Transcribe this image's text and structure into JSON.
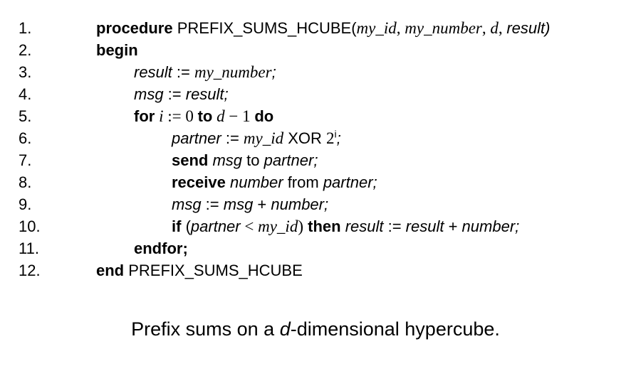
{
  "lines": [
    {
      "num": "1.",
      "indent": 0,
      "segs": [
        {
          "t": "procedure",
          "s": "kw"
        },
        {
          "t": " PREFIX_SUMS_HCUBE(",
          "s": ""
        },
        {
          "t": "my_id",
          "s": "math"
        },
        {
          "t": ", ",
          "s": "mathr"
        },
        {
          "t": "my_number",
          "s": "math"
        },
        {
          "t": ", ",
          "s": "mathr"
        },
        {
          "t": "d",
          "s": "math"
        },
        {
          "t": ", ",
          "s": "mathr"
        },
        {
          "t": "result)",
          "s": "it"
        }
      ]
    },
    {
      "num": "2.",
      "indent": 0,
      "segs": [
        {
          "t": "begin",
          "s": "kw"
        }
      ]
    },
    {
      "num": "3.",
      "indent": 1,
      "segs": [
        {
          "t": "result",
          "s": "it"
        },
        {
          "t": " := ",
          "s": ""
        },
        {
          "t": "my_number",
          "s": "math"
        },
        {
          "t": ";",
          "s": "it"
        }
      ]
    },
    {
      "num": "4.",
      "indent": 1,
      "segs": [
        {
          "t": "msg",
          "s": "it"
        },
        {
          "t": " := ",
          "s": ""
        },
        {
          "t": "result;",
          "s": "it"
        }
      ]
    },
    {
      "num": "5.",
      "indent": 1,
      "segs": [
        {
          "t": "for",
          "s": "kw"
        },
        {
          "t": " i",
          "s": "math"
        },
        {
          "t": " := 0 ",
          "s": "mathr"
        },
        {
          "t": "to",
          "s": "kw"
        },
        {
          "t": " d",
          "s": "math"
        },
        {
          "t": " − 1 ",
          "s": "mathr"
        },
        {
          "t": "do",
          "s": "kw"
        }
      ]
    },
    {
      "num": "6.",
      "indent": 2,
      "segs": [
        {
          "t": "partner",
          "s": "it"
        },
        {
          "t": " := ",
          "s": ""
        },
        {
          "t": "my_id",
          "s": "math"
        },
        {
          "t": " XOR ",
          "s": ""
        },
        {
          "t": "2",
          "s": "mathr"
        },
        {
          "t": "i",
          "s": "sup"
        },
        {
          "t": ";",
          "s": "it"
        }
      ]
    },
    {
      "num": "7.",
      "indent": 2,
      "segs": [
        {
          "t": "send",
          "s": "kw"
        },
        {
          "t": " ",
          "s": ""
        },
        {
          "t": "msg",
          "s": "it"
        },
        {
          "t": " to ",
          "s": ""
        },
        {
          "t": "partner;",
          "s": "it"
        }
      ]
    },
    {
      "num": "8.",
      "indent": 2,
      "segs": [
        {
          "t": "receive",
          "s": "kw"
        },
        {
          "t": " ",
          "s": ""
        },
        {
          "t": "number",
          "s": "it"
        },
        {
          "t": " from ",
          "s": ""
        },
        {
          "t": "partner;",
          "s": "it"
        }
      ]
    },
    {
      "num": "9.",
      "indent": 2,
      "segs": [
        {
          "t": "msg",
          "s": "it"
        },
        {
          "t": " := ",
          "s": ""
        },
        {
          "t": "msg",
          "s": "it"
        },
        {
          "t": " + ",
          "s": ""
        },
        {
          "t": "number;",
          "s": "it"
        }
      ]
    },
    {
      "num": "10.",
      "indent": 2,
      "segs": [
        {
          "t": "if",
          "s": "kw"
        },
        {
          "t": " (",
          "s": ""
        },
        {
          "t": "partner",
          "s": "it"
        },
        {
          "t": " < ",
          "s": "mathr"
        },
        {
          "t": "my_id",
          "s": "math"
        },
        {
          "t": ")",
          "s": "mathr"
        },
        {
          "t": " then",
          "s": "kw"
        },
        {
          "t": " ",
          "s": ""
        },
        {
          "t": "result",
          "s": "it"
        },
        {
          "t": " := ",
          "s": ""
        },
        {
          "t": "result",
          "s": "it"
        },
        {
          "t": " + ",
          "s": ""
        },
        {
          "t": "number;",
          "s": "it"
        }
      ]
    },
    {
      "num": "11.",
      "indent": 1,
      "segs": [
        {
          "t": "endfor;",
          "s": "kw"
        }
      ]
    },
    {
      "num": "12.",
      "indent": 0,
      "segs": [
        {
          "t": "end",
          "s": "kw"
        },
        {
          "t": " PREFIX_SUMS_HCUBE",
          "s": ""
        }
      ]
    }
  ],
  "caption": {
    "pre": "Prefix sums on a ",
    "em": "d",
    "post": "-dimensional hypercube."
  }
}
